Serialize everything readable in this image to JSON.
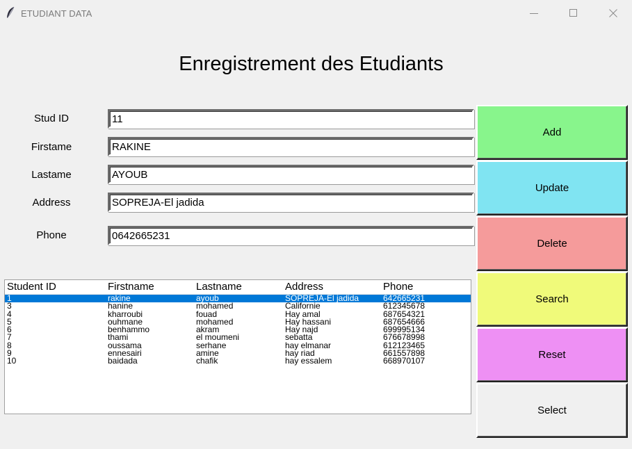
{
  "window": {
    "title": "ETUDIANT DATA",
    "controls": {
      "minimize_icon": "minimize-icon",
      "maximize_icon": "maximize-icon",
      "close_icon": "close-icon"
    }
  },
  "page": {
    "heading": "Enregistrement des Etudiants"
  },
  "form": {
    "fields": [
      {
        "label": "Stud ID",
        "value": "11"
      },
      {
        "label": "Firstame",
        "value": "RAKINE"
      },
      {
        "label": "Lastame",
        "value": "AYOUB"
      },
      {
        "label": "Address",
        "value": "SOPREJA-El jadida"
      },
      {
        "label": "Phone",
        "value": "0642665231"
      }
    ]
  },
  "actions": [
    {
      "label": "Add",
      "color": "#88f58c"
    },
    {
      "label": "Update",
      "color": "#80e4f2"
    },
    {
      "label": "Delete",
      "color": "#f59b9b"
    },
    {
      "label": "Search",
      "color": "#f0fa7a"
    },
    {
      "label": "Reset",
      "color": "#ee90f4"
    },
    {
      "label": "Select",
      "color": "#f0f0f0"
    }
  ],
  "table": {
    "columns": [
      "Student ID",
      "Firstname",
      "Lastname",
      "Address",
      "Phone"
    ],
    "selected_row": 0,
    "selection_color": "#0078d7",
    "rows": [
      [
        "1",
        "rakine",
        "ayoub",
        "SOPREJA-El jadida",
        "642665231"
      ],
      [
        "3",
        "hanine",
        "mohamed",
        "Californie",
        "612345678"
      ],
      [
        "4",
        "kharroubi",
        "fouad",
        "Hay amal",
        "687654321"
      ],
      [
        "5",
        "ouhmane",
        "mohamed",
        "Hay hassani",
        "687654666"
      ],
      [
        "6",
        "benhammo",
        "akram",
        "Hay najd",
        "699995134"
      ],
      [
        "7",
        "thami",
        "el moumeni",
        "sebatta",
        "676678998"
      ],
      [
        "8",
        "oussama",
        "serhane",
        "hay elmanar",
        "612123465"
      ],
      [
        "9",
        "ennesairi",
        "amine",
        "hay riad",
        "661557898"
      ],
      [
        "10",
        "baidada",
        "chafik",
        "hay essalem",
        "668970107"
      ]
    ]
  }
}
